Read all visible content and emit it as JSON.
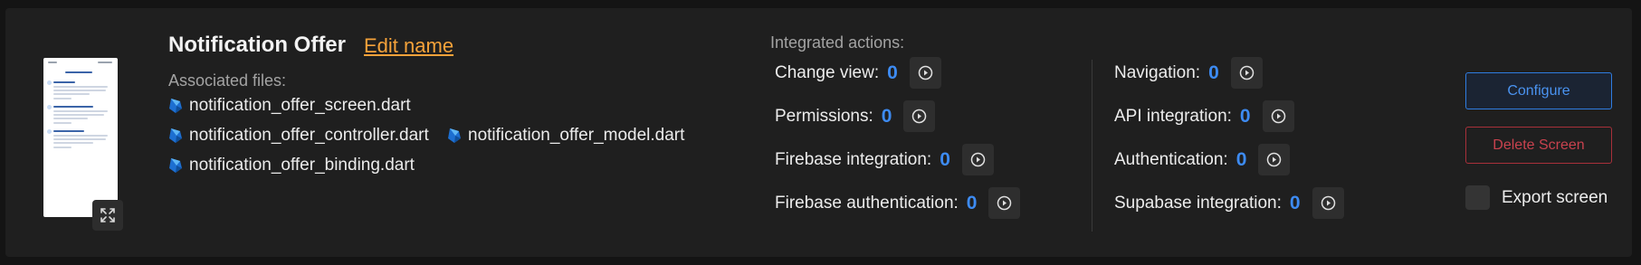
{
  "screen": {
    "title": "Notification Offer",
    "edit_name_label": "Edit name",
    "associated_files_label": "Associated files:",
    "files": [
      "notification_offer_screen.dart",
      "notification_offer_controller.dart",
      "notification_offer_model.dart",
      "notification_offer_binding.dart"
    ]
  },
  "integrated_actions": {
    "label": "Integrated actions:",
    "left": [
      {
        "label": "Change view:",
        "count": "0"
      },
      {
        "label": "Permissions:",
        "count": "0"
      },
      {
        "label": "Firebase integration:",
        "count": "0"
      },
      {
        "label": "Firebase authentication:",
        "count": "0"
      }
    ],
    "right": [
      {
        "label": "Navigation:",
        "count": "0"
      },
      {
        "label": "API integration:",
        "count": "0"
      },
      {
        "label": "Authentication:",
        "count": "0"
      },
      {
        "label": "Supabase integration:",
        "count": "0"
      }
    ]
  },
  "buttons": {
    "configure": "Configure",
    "delete": "Delete Screen",
    "export": "Export screen"
  },
  "colors": {
    "accent_blue": "#3d8bf2",
    "edit_orange": "#f5a23a",
    "delete_red": "#c8424e"
  },
  "icons": {
    "file": "dart-icon",
    "action": "play-icon",
    "expand": "expand-icon"
  }
}
